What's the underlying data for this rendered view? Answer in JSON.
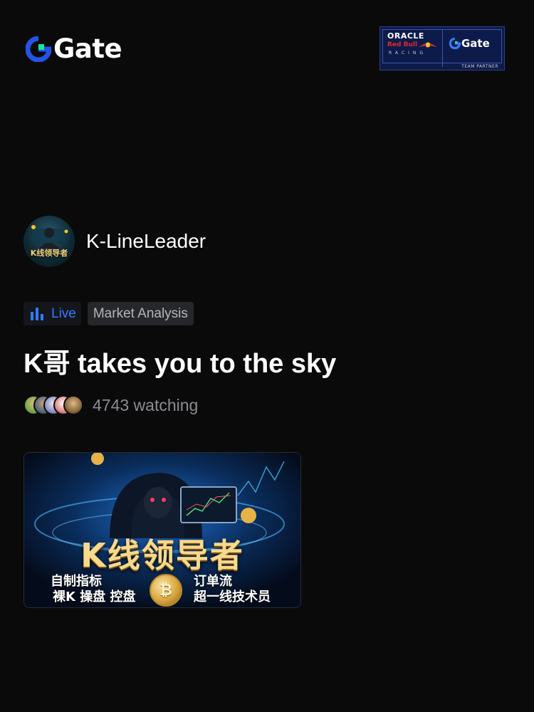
{
  "header": {
    "logo_text": "Gate",
    "partner_badge": {
      "oracle": "ORACLE",
      "redbull": "Red Bull",
      "racing": "RACING",
      "gate": "Gate",
      "team": "TEAM PARTNER"
    }
  },
  "streamer": {
    "name": "K-LineLeader",
    "avatar_text": "K线领导者"
  },
  "tags": {
    "live_label": "Live",
    "category": "Market Analysis"
  },
  "stream": {
    "title": "K哥 takes you to the sky",
    "viewer_count_text": "4743 watching"
  },
  "thumbnail": {
    "title": "K线领导者",
    "left_line1": "自制指标",
    "left_line2": "裸K 操盘 控盘",
    "right_line1": "订单流",
    "right_line2": "超一线技术员",
    "coin_symbol": "₿"
  },
  "colors": {
    "background": "#0a0a0b",
    "accent_blue": "#2f7bff",
    "gate_green": "#17e6a1",
    "gate_blue": "#2354e6"
  }
}
